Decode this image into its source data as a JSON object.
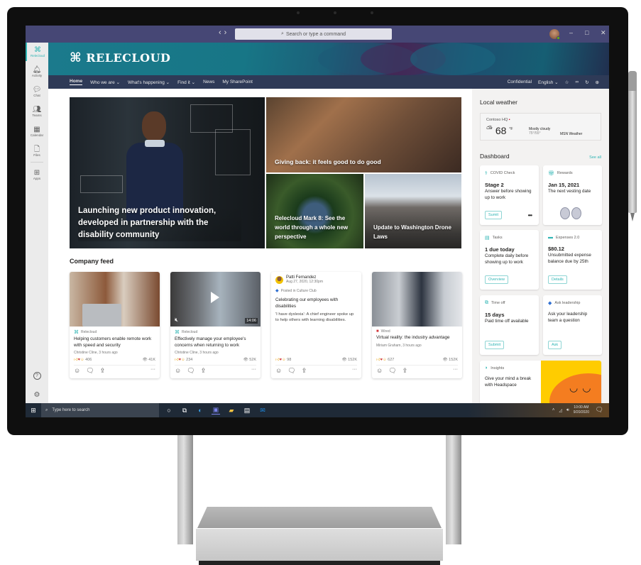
{
  "app": {
    "nav_back": "‹",
    "nav_forward": "›",
    "search_placeholder": "Search or type a command",
    "window_controls": {
      "minimize": "–",
      "maximize": "□",
      "close": "✕"
    }
  },
  "rail": {
    "items": [
      {
        "label": "Relecloud",
        "icon": "relecloud-logo-icon",
        "glyph": "⌘",
        "active": true
      },
      {
        "label": "Activity",
        "icon": "bell-icon",
        "glyph": "🔔︎"
      },
      {
        "label": "Chat",
        "icon": "chat-icon",
        "glyph": "💬︎"
      },
      {
        "label": "Teams",
        "icon": "teams-icon",
        "glyph": "👥︎"
      },
      {
        "label": "Calendar",
        "icon": "calendar-icon",
        "glyph": "▦"
      },
      {
        "label": "Files",
        "icon": "file-icon",
        "glyph": "🗋"
      },
      {
        "label": "Apps",
        "icon": "apps-icon",
        "glyph": "⊞"
      }
    ],
    "help_glyph": "?",
    "settings_glyph": "⚙"
  },
  "site": {
    "logo_text": "RELECLOUD",
    "logo_glyph": "⌘",
    "nav": [
      {
        "label": "Home",
        "dropdown": false,
        "active": true
      },
      {
        "label": "Who we are",
        "dropdown": true
      },
      {
        "label": "What's happening",
        "dropdown": true
      },
      {
        "label": "Find it",
        "dropdown": true
      },
      {
        "label": "News",
        "dropdown": false
      },
      {
        "label": "My SharePoint",
        "dropdown": false
      }
    ],
    "nav_right": {
      "confidential": "Confidential",
      "language": "English ⌄"
    }
  },
  "hero": {
    "tiles": [
      {
        "caption": "Launching new product innovation, developed in partnership with the disability community"
      },
      {
        "caption": "Giving back: it feels good to do good"
      },
      {
        "caption": "Relecloud Mark 8: See the world through a whole new perspective"
      },
      {
        "caption": "Update to Washington Drone Laws"
      }
    ]
  },
  "feed": {
    "title": "Company feed",
    "cards": [
      {
        "source": "Relecloud",
        "title": "Helping customers enable remote work with speed and security",
        "meta": "Christine Cline, 3 hours ago",
        "reactions": "406",
        "views": "41K"
      },
      {
        "source": "Relecloud",
        "title": "Effectively manage your employee's concerns when returning to work",
        "meta": "Christine Cline, 3 hours ago",
        "reactions": "234",
        "views": "52K",
        "duration": "14:06"
      },
      {
        "author": "Patti Fernandez",
        "date": "Aug 27, 2020, 12:30pm",
        "posted_in": "Posted in Culture Club",
        "title": "Celebrating our employees with disabilities",
        "body": "'I have dyslexia': A chief engineer spoke up to help others with learning disabilities.",
        "reactions": "98",
        "views": "152K"
      },
      {
        "source": "Wired",
        "title": "Virtual reality: the industry advantage",
        "meta": "Miriam Graham, 3 hours ago",
        "reactions": "627",
        "views": "152K"
      }
    ]
  },
  "weather": {
    "title": "Local weather",
    "location": "Contoso HQ",
    "temp": "68",
    "unit": "°F",
    "condition": "Mostly cloudy",
    "range": "75°/55°",
    "source": "MSN Weather"
  },
  "dashboard": {
    "title": "Dashboard",
    "see_all": "See all",
    "cards": [
      {
        "app": "COVID Check",
        "headline": "Stage 2",
        "desc": "Answer before showing up to work",
        "button": "Sumit",
        "more": "•••"
      },
      {
        "app": "Rewards",
        "headline": "Jan 15, 2021",
        "desc": "The next vesting date"
      },
      {
        "app": "Tasks",
        "headline": "1 due today",
        "desc": "Complete daily before showing up to work",
        "button": "Overview"
      },
      {
        "app": "Expenses 2.0",
        "headline": "$80.12",
        "desc": "Unsubmitted expense balance due by 25th",
        "button": "Details"
      },
      {
        "app": "Time off",
        "headline": "15 days",
        "desc": "Paid time off available",
        "button": "Submit"
      },
      {
        "app": "Ask leadership",
        "desc": "Ask your leadership team a question",
        "button": "Ask"
      },
      {
        "app": "Insights",
        "desc": "Give your mind a break with Headspace"
      }
    ]
  },
  "taskbar": {
    "search_placeholder": "Type here to search",
    "time": "10:00 AM",
    "date": "9/20/2020"
  }
}
